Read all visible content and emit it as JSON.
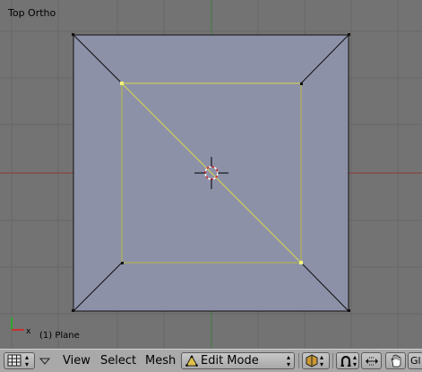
{
  "viewport": {
    "title": "Top Ortho",
    "object_label": "(1) Plane",
    "axis_x_label": "x",
    "colors": {
      "background": "#737373",
      "grid": "#676767",
      "x_axis": "#8e3a3a",
      "y_axis": "#3f7a3f",
      "face": "#8d91a8",
      "selected_edge": "#d6d84a",
      "vertex_selected": "#f2f27a"
    }
  },
  "toolbar": {
    "editor_icon": "grid-icon",
    "menus": [
      "View",
      "Select",
      "Mesh"
    ],
    "mode_label": "Edit Mode",
    "mode_icon": "triangle-mode-icon",
    "gl_label": "Gl"
  }
}
